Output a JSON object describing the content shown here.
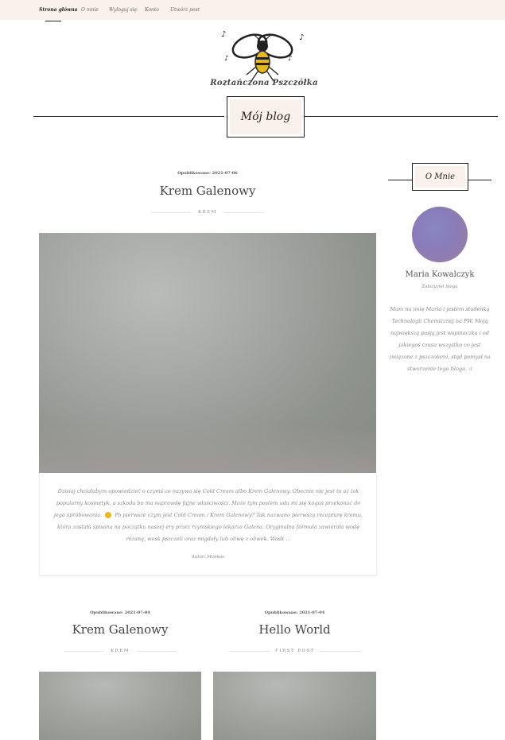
{
  "nav": {
    "items": [
      {
        "label": "Strona główna"
      },
      {
        "label": "O mnie"
      },
      {
        "label": "Wyloguj się"
      },
      {
        "label": "Konto"
      },
      {
        "label": "Utwórz post"
      }
    ]
  },
  "header": {
    "logo_text": "Roztańczona Pszczółka",
    "blog_title": "Mój blog"
  },
  "featured_post": {
    "published": "Opublikowane: 2021-07-06",
    "title": "Krem Galenowy",
    "category": "KREM",
    "excerpt_before": "Dzisiaj chciałabym opowiedzieć o czymś co nazywa się Cold Cream albo Krem Galenowy. Obecnie nie jest to aż tak popularny kosmetyk, a szkoda bo ma naprawdę fajne właściwości. Może tym postem uda mi się kogoś przekonać do jego spróbowania.",
    "excerpt_after": "Po pierwsze czym jest Cold Cream / Krem Galenowy? Tak nazwano pierwszą recepturę kremu, która została spisana na początku naszej ery przez rzymskiego lekarza Galena. Oryginalna formuła zawierała wodę różaną, wosk pszczeli oraz migdały lub oliwę z oliwek. Wosk ...",
    "author": "Autor: Monkos"
  },
  "sidebar": {
    "title": "O Mnie",
    "name": "Maria Kowalczyk",
    "role": "Założyciel bloga",
    "bio": "Mam na imię Maria i jestem studenką Technologii Chemicznej na PW. Moją największą pasją jest wspinaczka i od jakiegoś czasu wszystko co jest związane z pszczołami, stąd pomysł na stworzenie tego bloga. :)"
  },
  "posts": [
    {
      "published": "Opublikowane: 2021-07-04",
      "title": "Krem Galenowy",
      "category": "KREM"
    },
    {
      "published": "Opublikowane: 2021-07-04",
      "title": "Hello World",
      "category": "FIRST POST"
    }
  ]
}
